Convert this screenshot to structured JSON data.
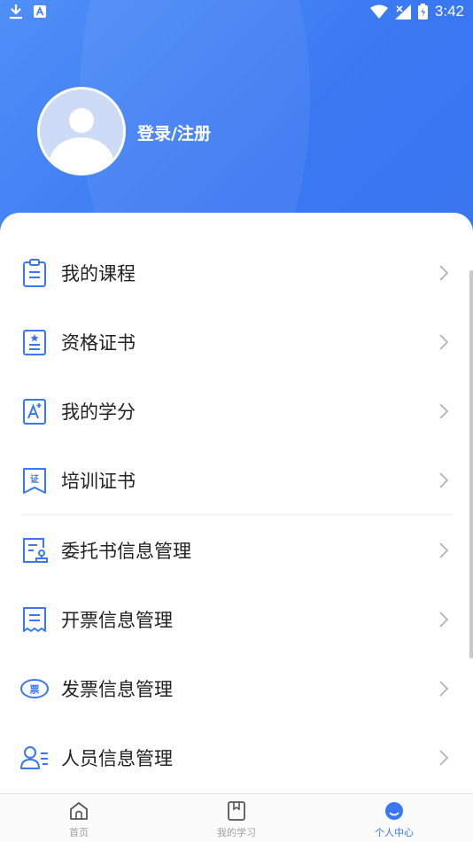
{
  "status_bar": {
    "time": "3:42",
    "icons": [
      "download-icon",
      "notification-a-icon",
      "wifi-icon",
      "signal-icon",
      "battery-icon"
    ]
  },
  "profile": {
    "login_label": "登录/注册"
  },
  "menu": {
    "items": [
      {
        "label": "我的课程",
        "icon": "clipboard-icon"
      },
      {
        "label": "资格证书",
        "icon": "certificate-star-icon"
      },
      {
        "label": "我的学分",
        "icon": "score-a-icon"
      },
      {
        "label": "培训证书",
        "icon": "training-cert-icon"
      },
      {
        "label": "委托书信息管理",
        "icon": "entrust-doc-icon"
      },
      {
        "label": "开票信息管理",
        "icon": "invoice-icon"
      },
      {
        "label": "发票信息管理",
        "icon": "ticket-icon"
      },
      {
        "label": "人员信息管理",
        "icon": "person-list-icon"
      }
    ]
  },
  "tabbar": {
    "tabs": [
      {
        "label": "首页",
        "icon": "home-icon",
        "active": false
      },
      {
        "label": "我的学习",
        "icon": "bookmark-book-icon",
        "active": false
      },
      {
        "label": "个人中心",
        "icon": "person-circle-icon",
        "active": true
      }
    ]
  },
  "colors": {
    "accent": "#3a78f2",
    "header_gradient_start": "#4f8ff7",
    "text": "#222222",
    "inactive_tab": "#a0a0a0"
  }
}
